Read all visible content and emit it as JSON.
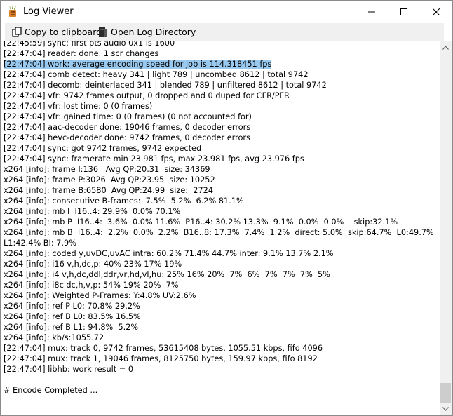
{
  "window": {
    "title": "Log Viewer"
  },
  "toolbar": {
    "copy_label": "Copy to clipboard",
    "open_label": "Open Log Directory"
  },
  "log": {
    "highlighted_index": 2,
    "lines": [
      "[22:45:59] sync: first pts audio 0x1 is 1600",
      "[22:47:04] reader: done. 1 scr changes",
      "[22:47:04] work: average encoding speed for job is 114.318451 fps",
      "[22:47:04] comb detect: heavy 341 | light 789 | uncombed 8612 | total 9742",
      "[22:47:04] decomb: deinterlaced 341 | blended 789 | unfiltered 8612 | total 9742",
      "[22:47:04] vfr: 9742 frames output, 0 dropped and 0 duped for CFR/PFR",
      "[22:47:04] vfr: lost time: 0 (0 frames)",
      "[22:47:04] vfr: gained time: 0 (0 frames) (0 not accounted for)",
      "[22:47:04] aac-decoder done: 19046 frames, 0 decoder errors",
      "[22:47:04] hevc-decoder done: 9742 frames, 0 decoder errors",
      "[22:47:04] sync: got 9742 frames, 9742 expected",
      "[22:47:04] sync: framerate min 23.981 fps, max 23.981 fps, avg 23.976 fps",
      "x264 [info]: frame I:136   Avg QP:20.31  size: 34369",
      "x264 [info]: frame P:3026  Avg QP:23.95  size: 10252",
      "x264 [info]: frame B:6580  Avg QP:24.99  size:  2724",
      "x264 [info]: consecutive B-frames:  7.5%  5.2%  6.2% 81.1%",
      "x264 [info]: mb I  I16..4: 29.9%  0.0% 70.1%",
      "x264 [info]: mb P  I16..4:  3.6%  0.0% 11.6%  P16..4: 30.2% 13.3%  9.1%  0.0%  0.0%    skip:32.1%",
      "x264 [info]: mb B  I16..4:  2.2%  0.0%  2.2%  B16..8: 17.3%  7.4%  1.2%  direct: 5.0%  skip:64.7%  L0:49.7% L1:42.4% BI: 7.9%",
      "x264 [info]: coded y,uvDC,uvAC intra: 60.2% 71.4% 44.7% inter: 9.1% 13.7% 2.1%",
      "x264 [info]: i16 v,h,dc,p: 40% 23% 17% 19%",
      "x264 [info]: i4 v,h,dc,ddl,ddr,vr,hd,vl,hu: 25% 16% 20%  7%  6%  7%  7%  7%  5%",
      "x264 [info]: i8c dc,h,v,p: 54% 19% 20%  7%",
      "x264 [info]: Weighted P-Frames: Y:4.8% UV:2.6%",
      "x264 [info]: ref P L0: 70.8% 29.2%",
      "x264 [info]: ref B L0: 83.5% 16.5%",
      "x264 [info]: ref B L1: 94.8%  5.2%",
      "x264 [info]: kb/s:1055.72",
      "[22:47:04] mux: track 0, 9742 frames, 53615408 bytes, 1055.51 kbps, fifo 4096",
      "[22:47:04] mux: track 1, 19046 frames, 8125750 bytes, 159.97 kbps, fifo 8192",
      "[22:47:04] libhb: work result = 0",
      "",
      "# Encode Completed ..."
    ]
  },
  "colors": {
    "highlight": "#99c9ef",
    "toolbar_bg": "#f0f0f0",
    "scroll_thumb": "#cdcdcd"
  }
}
